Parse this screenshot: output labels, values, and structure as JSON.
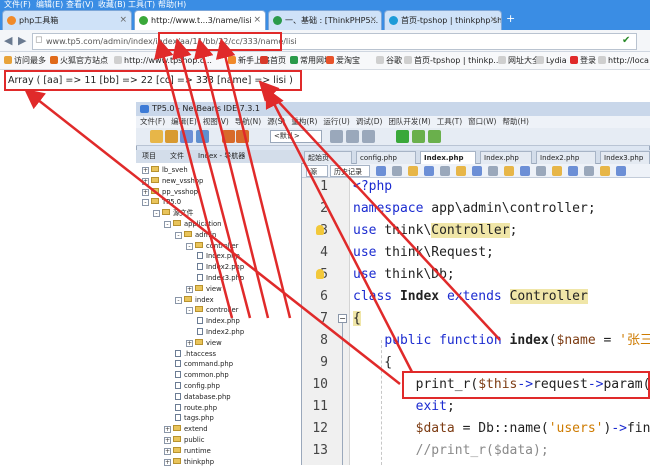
{
  "browser": {
    "menu": [
      "文件(F)",
      "编辑(E)",
      "查看(V)",
      "收藏(B)",
      "工具(T)",
      "帮助(H)"
    ],
    "tabs": [
      {
        "label": "php工具箱"
      },
      {
        "label": "http://www.t...3/name/lisi",
        "active": true
      },
      {
        "label": "一、基础 : [ThinkPHP5..."
      },
      {
        "label": "首页-tpshop | thinkphp sho..."
      }
    ],
    "url": "www.tp5.com/admin/index/index/aa/11/bb/22/cc/333/name/lisi",
    "bookmarks": [
      "访问最多",
      "火狐官方站点",
      "http://www.tpshop.c...",
      "新手上路",
      "首页",
      "常用网址",
      "爱淘宝",
      "谷歌",
      "首页-tpshop | thinkp...",
      "网址大全",
      "Lydia",
      "登录",
      "http://loca"
    ]
  },
  "output_text": "Array ( [aa] => 11 [bb] => 22 [cc] => 333 [name] => lisi )",
  "ide": {
    "title": "TP5.0 - NetBeans IDE 7.3.1",
    "menu": [
      "文件(F)",
      "编辑(E)",
      "视图(V)",
      "导航(N)",
      "源(S)",
      "重构(R)",
      "运行(U)",
      "调试(D)",
      "团队开发(M)",
      "工具(T)",
      "窗口(W)",
      "帮助(H)"
    ],
    "toolbar_combo": "<默认>",
    "panel_tabs": [
      "项目",
      "文件",
      "Index - 导航器"
    ],
    "tree": [
      {
        "label": "lb_sveh",
        "type": "folder",
        "indent": 0,
        "exp": "+"
      },
      {
        "label": "new_vsshop",
        "type": "folder",
        "indent": 0,
        "exp": "+"
      },
      {
        "label": "pp_vsshop",
        "type": "folder",
        "indent": 0,
        "exp": "+"
      },
      {
        "label": "TP5.0",
        "type": "folder",
        "indent": 0,
        "exp": "-"
      },
      {
        "label": "源文件",
        "type": "folder",
        "indent": 1,
        "exp": "-"
      },
      {
        "label": "application",
        "type": "folder",
        "indent": 2,
        "exp": "-"
      },
      {
        "label": "admin",
        "type": "folder",
        "indent": 3,
        "exp": "-"
      },
      {
        "label": "controller",
        "type": "folder",
        "indent": 4,
        "exp": "-"
      },
      {
        "label": "Index.php",
        "type": "file",
        "indent": 5
      },
      {
        "label": "Index2.php",
        "type": "file",
        "indent": 5
      },
      {
        "label": "Index3.php",
        "type": "file",
        "indent": 5
      },
      {
        "label": "view",
        "type": "folder",
        "indent": 4,
        "exp": "+"
      },
      {
        "label": "index",
        "type": "folder",
        "indent": 3,
        "exp": "-"
      },
      {
        "label": "controller",
        "type": "folder",
        "indent": 4,
        "exp": "-"
      },
      {
        "label": "Index.php",
        "type": "file",
        "indent": 5
      },
      {
        "label": "Index2.php",
        "type": "file",
        "indent": 5
      },
      {
        "label": "view",
        "type": "folder",
        "indent": 4,
        "exp": "+"
      },
      {
        "label": ".htaccess",
        "type": "file",
        "indent": 3
      },
      {
        "label": "command.php",
        "type": "file",
        "indent": 3
      },
      {
        "label": "common.php",
        "type": "file",
        "indent": 3
      },
      {
        "label": "config.php",
        "type": "file",
        "indent": 3
      },
      {
        "label": "database.php",
        "type": "file",
        "indent": 3
      },
      {
        "label": "route.php",
        "type": "file",
        "indent": 3
      },
      {
        "label": "tags.php",
        "type": "file",
        "indent": 3
      },
      {
        "label": "extend",
        "type": "folder",
        "indent": 2,
        "exp": "+"
      },
      {
        "label": "public",
        "type": "folder",
        "indent": 2,
        "exp": "+"
      },
      {
        "label": "runtime",
        "type": "folder",
        "indent": 2,
        "exp": "+"
      },
      {
        "label": "thinkphp",
        "type": "folder",
        "indent": 2,
        "exp": "+"
      }
    ],
    "editor_tabs": [
      "起始页",
      "config.php",
      "Index.php",
      "Index.php",
      "Index2.php",
      "Index3.php"
    ],
    "editor_subtabs": [
      "源",
      "历史记录"
    ],
    "line_numbers": [
      "1",
      "2",
      "3",
      "4",
      "5",
      "6",
      "7",
      "8",
      "9",
      "10",
      "11",
      "12",
      "13"
    ],
    "code_lines": [
      "<?php",
      "namespace app\\admin\\controller;",
      "use think\\Controller;",
      "use think\\Request;",
      "use think\\Db;",
      "class Index extends Controller",
      "{",
      "    public function index($name = '张三')",
      "    {",
      "        print_r($this->request->param());",
      "        exit;",
      "        $data = Db::name('users')->find()",
      "        //print_r($data);"
    ]
  },
  "colors": {
    "annotation": "#e02a2a",
    "browser_bar": "#3a8de4",
    "keyword": "#1b2bd0"
  }
}
